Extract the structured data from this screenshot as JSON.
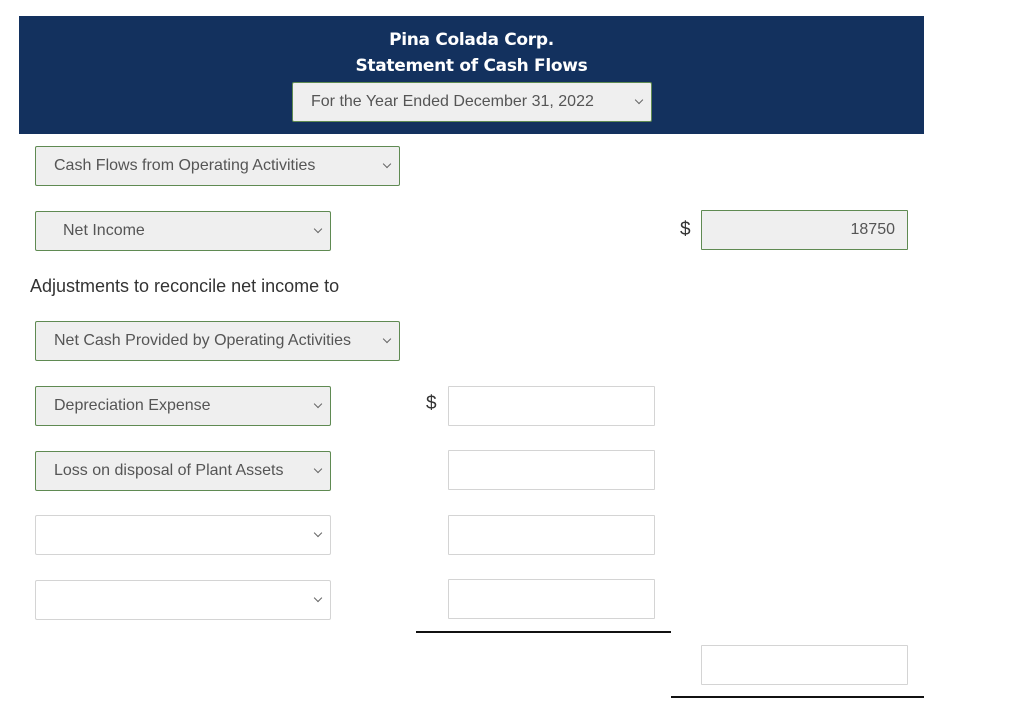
{
  "header": {
    "company": "Pina Colada Corp.",
    "statement": "Statement of Cash Flows",
    "period_select": {
      "value": "For the Year Ended December 31, 2022"
    }
  },
  "section_select": {
    "value": "Cash Flows from Operating Activities"
  },
  "net_income": {
    "select_value": "Net Income",
    "currency": "$",
    "amount": "18750"
  },
  "adjustments_label": "Adjustments to reconcile net income to",
  "adjustments_select": {
    "value": "Net Cash Provided by Operating Activities"
  },
  "adjustment_rows": [
    {
      "select_value": "Depreciation Expense",
      "currency": "$",
      "amount": ""
    },
    {
      "select_value": "Loss on disposal of Plant Assets",
      "currency": "",
      "amount": ""
    },
    {
      "select_value": "",
      "currency": "",
      "amount": ""
    },
    {
      "select_value": "",
      "currency": "",
      "amount": ""
    }
  ],
  "total": {
    "amount": ""
  },
  "colors": {
    "header_bg": "#13315e",
    "select_border": "#5f8a52",
    "select_bg": "#efefef"
  }
}
